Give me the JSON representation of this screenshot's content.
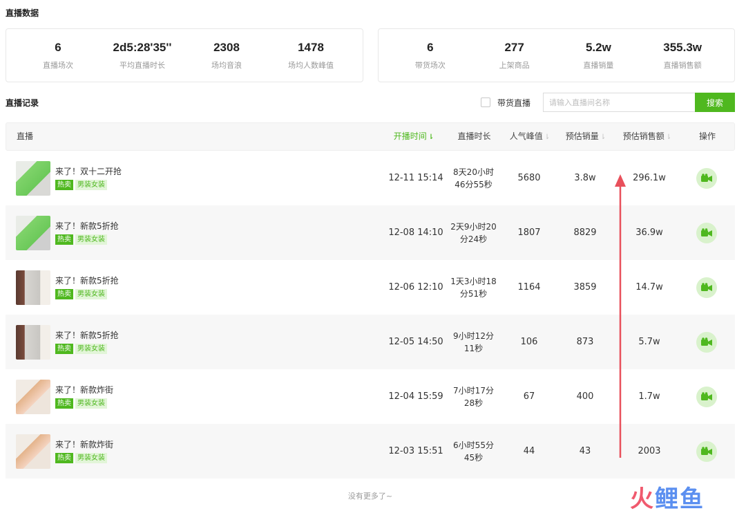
{
  "sections": {
    "stats_title": "直播数据",
    "records_title": "直播记录"
  },
  "stats_left": [
    {
      "value": "6",
      "label": "直播场次"
    },
    {
      "value": "2d5:28'35''",
      "label": "平均直播时长"
    },
    {
      "value": "2308",
      "label": "场均音浪"
    },
    {
      "value": "1478",
      "label": "场均人数峰值"
    }
  ],
  "stats_right": [
    {
      "value": "6",
      "label": "带货场次"
    },
    {
      "value": "277",
      "label": "上架商品"
    },
    {
      "value": "5.2w",
      "label": "直播销量"
    },
    {
      "value": "355.3w",
      "label": "直播销售额"
    }
  ],
  "filter": {
    "checkbox_label": "带货直播",
    "checkbox_checked": false,
    "search_placeholder": "请输入直播间名称",
    "search_value": "",
    "search_button": "搜索"
  },
  "table": {
    "headers": {
      "stream": "直播",
      "start_time": "开播时间",
      "duration": "直播时长",
      "peak": "人气峰值",
      "est_sales": "预估销量",
      "est_revenue": "预估销售额",
      "action": "操作"
    },
    "rows": [
      {
        "title": "来了！双十二开抢",
        "tag_hot": "热卖",
        "tag_cat": "男装女装",
        "start": "12-11 15:14",
        "duration": "8天20小时46分55秒",
        "peak": "5680",
        "sales": "3.8w",
        "revenue": "296.1w"
      },
      {
        "title": "来了！新款5折抢",
        "tag_hot": "热卖",
        "tag_cat": "男装女装",
        "start": "12-08 14:10",
        "duration": "2天9小时20分24秒",
        "peak": "1807",
        "sales": "8829",
        "revenue": "36.9w"
      },
      {
        "title": "来了！新款5折抢",
        "tag_hot": "热卖",
        "tag_cat": "男装女装",
        "start": "12-06 12:10",
        "duration": "1天3小时18分51秒",
        "peak": "1164",
        "sales": "3859",
        "revenue": "14.7w"
      },
      {
        "title": "来了！新款5折抢",
        "tag_hot": "热卖",
        "tag_cat": "男装女装",
        "start": "12-05 14:50",
        "duration": "9小时12分11秒",
        "peak": "106",
        "sales": "873",
        "revenue": "5.7w"
      },
      {
        "title": "来了！新款炸街",
        "tag_hot": "热卖",
        "tag_cat": "男装女装",
        "start": "12-04 15:59",
        "duration": "7小时17分28秒",
        "peak": "67",
        "sales": "400",
        "revenue": "1.7w"
      },
      {
        "title": "来了！新款炸街",
        "tag_hot": "热卖",
        "tag_cat": "男装女装",
        "start": "12-03 15:51",
        "duration": "6小时55分45秒",
        "peak": "44",
        "sales": "43",
        "revenue": "2003"
      }
    ]
  },
  "footer": {
    "no_more": "没有更多了~"
  },
  "watermark": {
    "part1": "火",
    "part2": "鲤鱼"
  },
  "colors": {
    "accent": "#4fb81f",
    "arrow": "#e8505b"
  },
  "icons": {
    "sort_active": "sort-down-icon",
    "sort": "sort-icon",
    "action": "video-camera-icon"
  }
}
